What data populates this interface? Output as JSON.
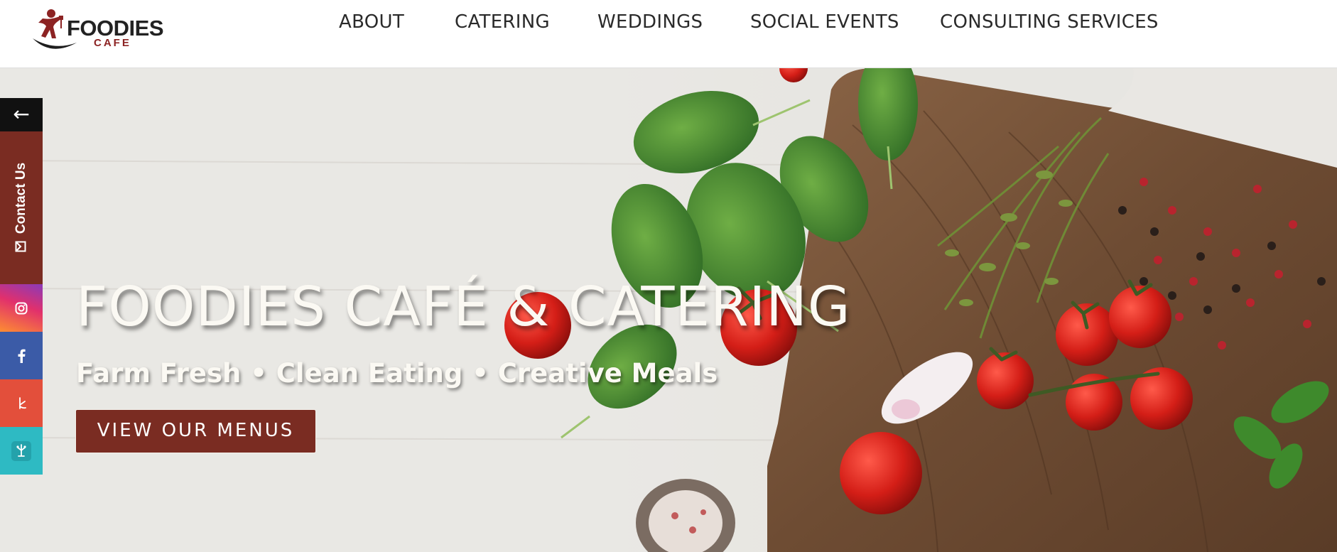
{
  "logo": {
    "word": "FOODIES",
    "sub": "CAFE"
  },
  "nav": {
    "items": [
      {
        "label": "ABOUT"
      },
      {
        "label": "CATERING"
      },
      {
        "label": "WEDDINGS"
      },
      {
        "label": "SOCIAL EVENTS"
      },
      {
        "label": "CONSULTING SERVICES"
      }
    ]
  },
  "hero": {
    "title": "FOODIES CAFÉ & CATERING",
    "subtitle": "Farm Fresh • Clean Eating • Creative Meals",
    "button_label": "VIEW OUR MENUS"
  },
  "sidebar": {
    "collapse_glyph": "←",
    "contact_label": "Contact Us",
    "social": [
      {
        "name": "instagram-icon",
        "color": "#d6266f"
      },
      {
        "name": "facebook-icon",
        "color": "#3b5ba7"
      },
      {
        "name": "yelp-icon",
        "color": "#e34f3b"
      },
      {
        "name": "tripadvisor-icon",
        "color": "#2ebac3"
      }
    ]
  },
  "colors": {
    "brand": "#7a2c22",
    "logo_red": "#8c2323",
    "nav_text": "#2a2a2a"
  }
}
